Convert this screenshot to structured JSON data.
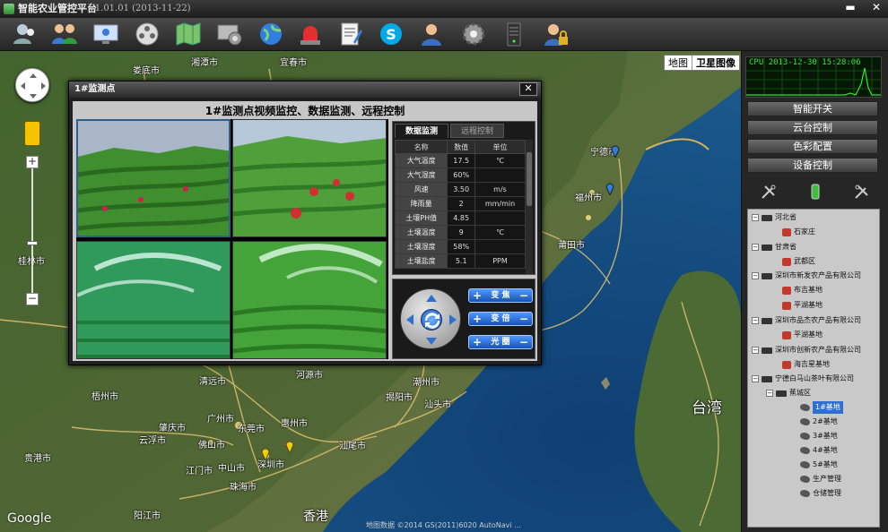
{
  "app": {
    "title": "智能农业管控平台",
    "version": "- V1.01.01 (2013-11-22)",
    "minimize": "▬",
    "close": "✕"
  },
  "toolbar_icons": [
    "users-icon",
    "group-icon",
    "monitor-icon",
    "film-icon",
    "map-icon",
    "settings-display-icon",
    "globe-icon",
    "alarm-icon",
    "document-icon",
    "skype-icon",
    "user-icon",
    "gear-icon",
    "server-icon",
    "lock-user-icon"
  ],
  "map": {
    "type_map": "地图",
    "type_satellite": "卫星图像",
    "zoom_in": "+",
    "zoom_out": "−",
    "google": "Google",
    "attribution": "地图数据 ©2014 GS(2011)6020 AutoNavi ...",
    "labels": [
      {
        "name": "娄底市"
      },
      {
        "name": "湘潭市"
      },
      {
        "name": "宜春市"
      },
      {
        "name": "宁德市"
      },
      {
        "name": "福州市"
      },
      {
        "name": "莆田市"
      },
      {
        "name": "桂林市"
      },
      {
        "name": "河源市"
      },
      {
        "name": "清远市"
      },
      {
        "name": "梧州市"
      },
      {
        "name": "广州市"
      },
      {
        "name": "东莞市"
      },
      {
        "name": "惠州市"
      },
      {
        "name": "佛山市"
      },
      {
        "name": "江门市"
      },
      {
        "name": "中山市"
      },
      {
        "name": "深圳市"
      },
      {
        "name": "珠海市"
      },
      {
        "name": "汕尾市"
      },
      {
        "name": "揭阳市"
      },
      {
        "name": "潮州市"
      },
      {
        "name": "汕头市"
      },
      {
        "name": "肇庆市"
      },
      {
        "name": "云浮市"
      },
      {
        "name": "贵港市"
      },
      {
        "name": "阳江市"
      },
      {
        "name": "香港"
      },
      {
        "name": "台湾"
      }
    ]
  },
  "popup": {
    "title": "1#监测点",
    "heading": "1#监测点视频监控、数据监测、远程控制",
    "close": "✕",
    "tabs": [
      "数据监测",
      "远程控制"
    ],
    "table_headers": [
      "名称",
      "数值",
      "单位"
    ],
    "rows": [
      {
        "name": "大气温度",
        "value": "17.5",
        "unit": "℃"
      },
      {
        "name": "大气湿度",
        "value": "60%",
        "unit": ""
      },
      {
        "name": "风速",
        "value": "3.50",
        "unit": "m/s"
      },
      {
        "name": "降雨量",
        "value": "2",
        "unit": "mm/min"
      },
      {
        "name": "土壤PH值",
        "value": "4.85",
        "unit": ""
      },
      {
        "name": "土壤温度",
        "value": "9",
        "unit": "℃"
      },
      {
        "name": "土壤湿度",
        "value": "58%",
        "unit": ""
      },
      {
        "name": "土壤盐度",
        "value": "5.1",
        "unit": "PPM"
      }
    ],
    "controls": [
      {
        "label": "变 焦",
        "plus": "+",
        "minus": "−"
      },
      {
        "label": "变 倍",
        "plus": "+",
        "minus": "−"
      },
      {
        "label": "光 圈",
        "plus": "+",
        "minus": "−"
      }
    ]
  },
  "cpu": {
    "label": "CPU 2013-12-30 15:28:06"
  },
  "menu": [
    "智能开关",
    "云台控制",
    "色彩配置",
    "设备控制"
  ],
  "tree": [
    {
      "label": "河北省",
      "kind": "group",
      "exp": "−"
    },
    {
      "label": "石家庄",
      "kind": "base"
    },
    {
      "label": "甘肃省",
      "kind": "group",
      "exp": "−"
    },
    {
      "label": "武都区",
      "kind": "base"
    },
    {
      "label": "深圳市新发农产品有限公司",
      "kind": "group",
      "exp": "−"
    },
    {
      "label": "布吉基地",
      "kind": "base"
    },
    {
      "label": "平湖基地",
      "kind": "base"
    },
    {
      "label": "深圳市品杰农产品有限公司",
      "kind": "group",
      "exp": "−"
    },
    {
      "label": "平湖基地",
      "kind": "base"
    },
    {
      "label": "深圳市创新农产品有限公司",
      "kind": "group",
      "exp": "−"
    },
    {
      "label": "海吉星基地",
      "kind": "base"
    },
    {
      "label": "宁德白马山茶叶有限公司",
      "kind": "group",
      "exp": "−"
    },
    {
      "label": "蕉城区",
      "kind": "group",
      "exp": "−"
    },
    {
      "label": "1#基地",
      "kind": "cam",
      "selected": true
    },
    {
      "label": "2#基地",
      "kind": "cam"
    },
    {
      "label": "3#基地",
      "kind": "cam"
    },
    {
      "label": "4#基地",
      "kind": "cam"
    },
    {
      "label": "5#基地",
      "kind": "cam"
    },
    {
      "label": "生产管理",
      "kind": "cam"
    },
    {
      "label": "仓储管理",
      "kind": "cam"
    }
  ]
}
